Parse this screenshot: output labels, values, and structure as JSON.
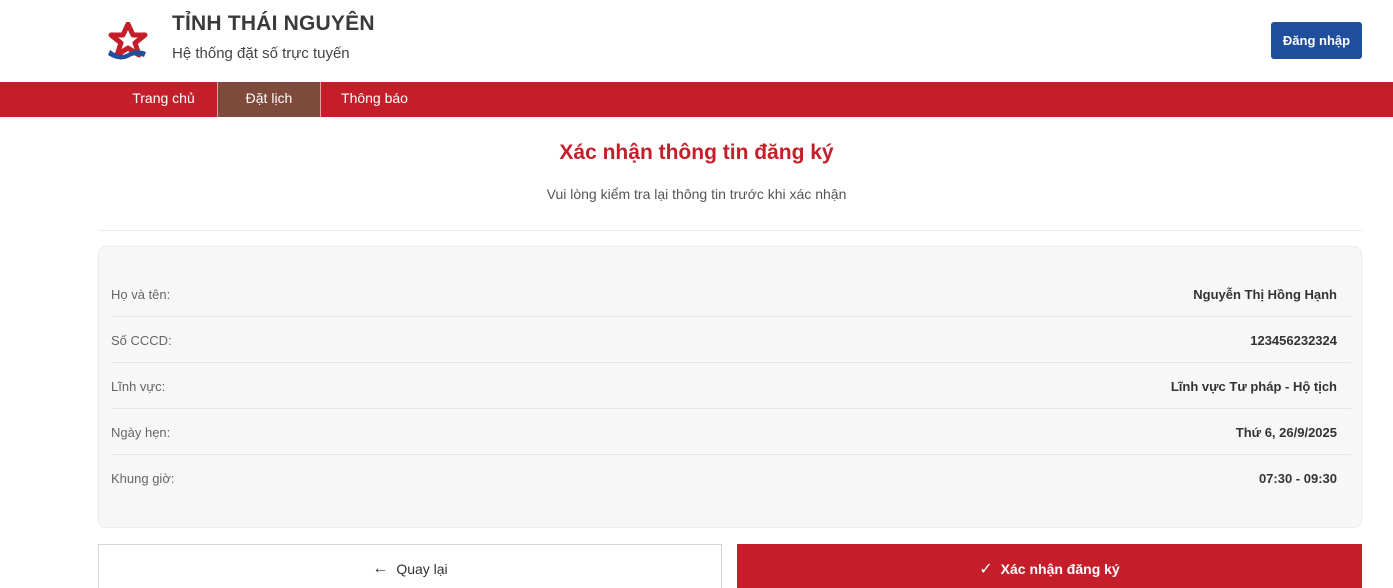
{
  "header": {
    "title": "TỈNH THÁI NGUYÊN",
    "subtitle": "Hệ thống đặt số trực tuyến",
    "login_label": "Đăng nhập"
  },
  "nav": {
    "items": [
      {
        "label": "Trang chủ",
        "active": false
      },
      {
        "label": "Đặt lịch",
        "active": true
      },
      {
        "label": "Thông báo",
        "active": false
      }
    ]
  },
  "page": {
    "title": "Xác nhận thông tin đăng ký",
    "subtitle": "Vui lòng kiểm tra lại thông tin trước khi xác nhận"
  },
  "details": [
    {
      "label": "Họ và tên:",
      "value": "Nguyễn Thị Hồng Hạnh"
    },
    {
      "label": "Số CCCD:",
      "value": "123456232324"
    },
    {
      "label": "Lĩnh vực:",
      "value": "Lĩnh vực Tư pháp - Hộ tịch"
    },
    {
      "label": "Ngày hẹn:",
      "value": "Thứ 6, 26/9/2025"
    },
    {
      "label": "Khung giờ:",
      "value": "07:30 - 09:30"
    }
  ],
  "actions": {
    "back_label": "Quay lại",
    "back_icon": "arrow-left-icon",
    "confirm_label": "Xác nhận đăng ký",
    "confirm_icon": "check-icon"
  },
  "colors": {
    "brand_red": "#c41e2a",
    "active_nav": "#7d4a3c",
    "login_blue": "#1f4e9c"
  }
}
